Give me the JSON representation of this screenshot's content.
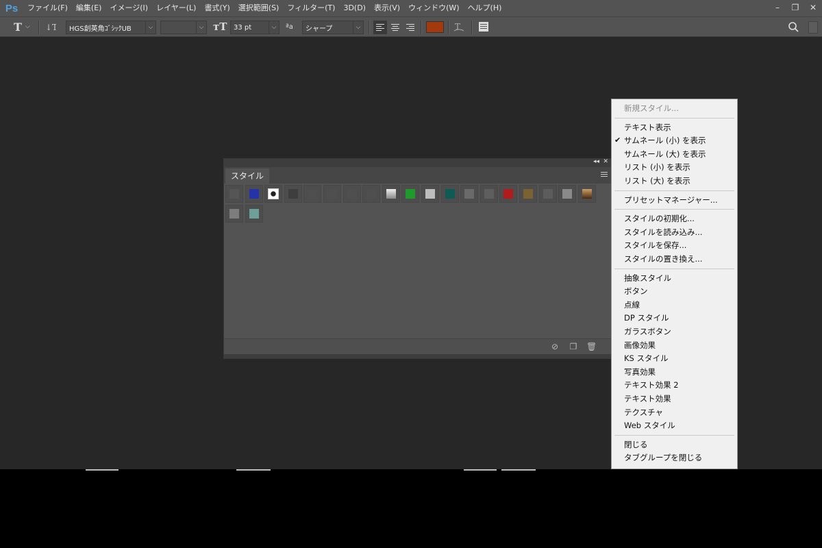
{
  "app": {
    "logo": "Ps"
  },
  "menubar": {
    "items": [
      "ファイル(F)",
      "編集(E)",
      "イメージ(I)",
      "レイヤー(L)",
      "書式(Y)",
      "選択範囲(S)",
      "フィルター(T)",
      "3D(D)",
      "表示(V)",
      "ウィンドウ(W)",
      "ヘルプ(H)"
    ]
  },
  "window_controls": {
    "minimize": "–",
    "restore": "❐",
    "close": "✕"
  },
  "options": {
    "font_family": "HGS創英角ｺﾞｼｯｸUB",
    "font_style": "",
    "font_size": "33 pt",
    "antialias": "シャープ",
    "text_color": "#a23a0e"
  },
  "panel": {
    "tab": "スタイル",
    "swatches": [
      "#555555",
      "#2433a8",
      "#ffffff",
      "#3e3e3e",
      "#4f4f4f",
      "#4f4f4f",
      "#4f4f4f",
      "#4f4f4f",
      "#bcbcbc",
      "#1f9a2c",
      "#bdbdbd",
      "#0f5a52",
      "#6a6a6a",
      "#5e5e5e",
      "#b01c1c",
      "#7a6233",
      "#5c5c5c",
      "#8a8a8a",
      "#8b5e27",
      "#7d7d7d",
      "#6e9e9a"
    ]
  },
  "context_menu": {
    "items": [
      {
        "label": "新規スタイル...",
        "disabled": true
      },
      {
        "sep": true
      },
      {
        "label": "テキスト表示"
      },
      {
        "label": "サムネール (小) を表示",
        "checked": true
      },
      {
        "label": "サムネール (大) を表示"
      },
      {
        "label": "リスト (小) を表示"
      },
      {
        "label": "リスト (大) を表示"
      },
      {
        "sep": true
      },
      {
        "label": "プリセットマネージャー..."
      },
      {
        "sep": true
      },
      {
        "label": "スタイルの初期化..."
      },
      {
        "label": "スタイルを読み込み..."
      },
      {
        "label": "スタイルを保存..."
      },
      {
        "label": "スタイルの置き換え..."
      },
      {
        "sep": true
      },
      {
        "label": "抽象スタイル"
      },
      {
        "label": "ボタン"
      },
      {
        "label": "点線"
      },
      {
        "label": "DP スタイル"
      },
      {
        "label": "ガラスボタン"
      },
      {
        "label": "画像効果"
      },
      {
        "label": "KS スタイル"
      },
      {
        "label": "写真効果"
      },
      {
        "label": "テキスト効果 2"
      },
      {
        "label": "テキスト効果"
      },
      {
        "label": "テクスチャ"
      },
      {
        "label": "Web スタイル"
      },
      {
        "sep": true
      },
      {
        "label": "閉じる"
      },
      {
        "label": "タブグループを閉じる"
      }
    ],
    "check_mark": "✔"
  }
}
